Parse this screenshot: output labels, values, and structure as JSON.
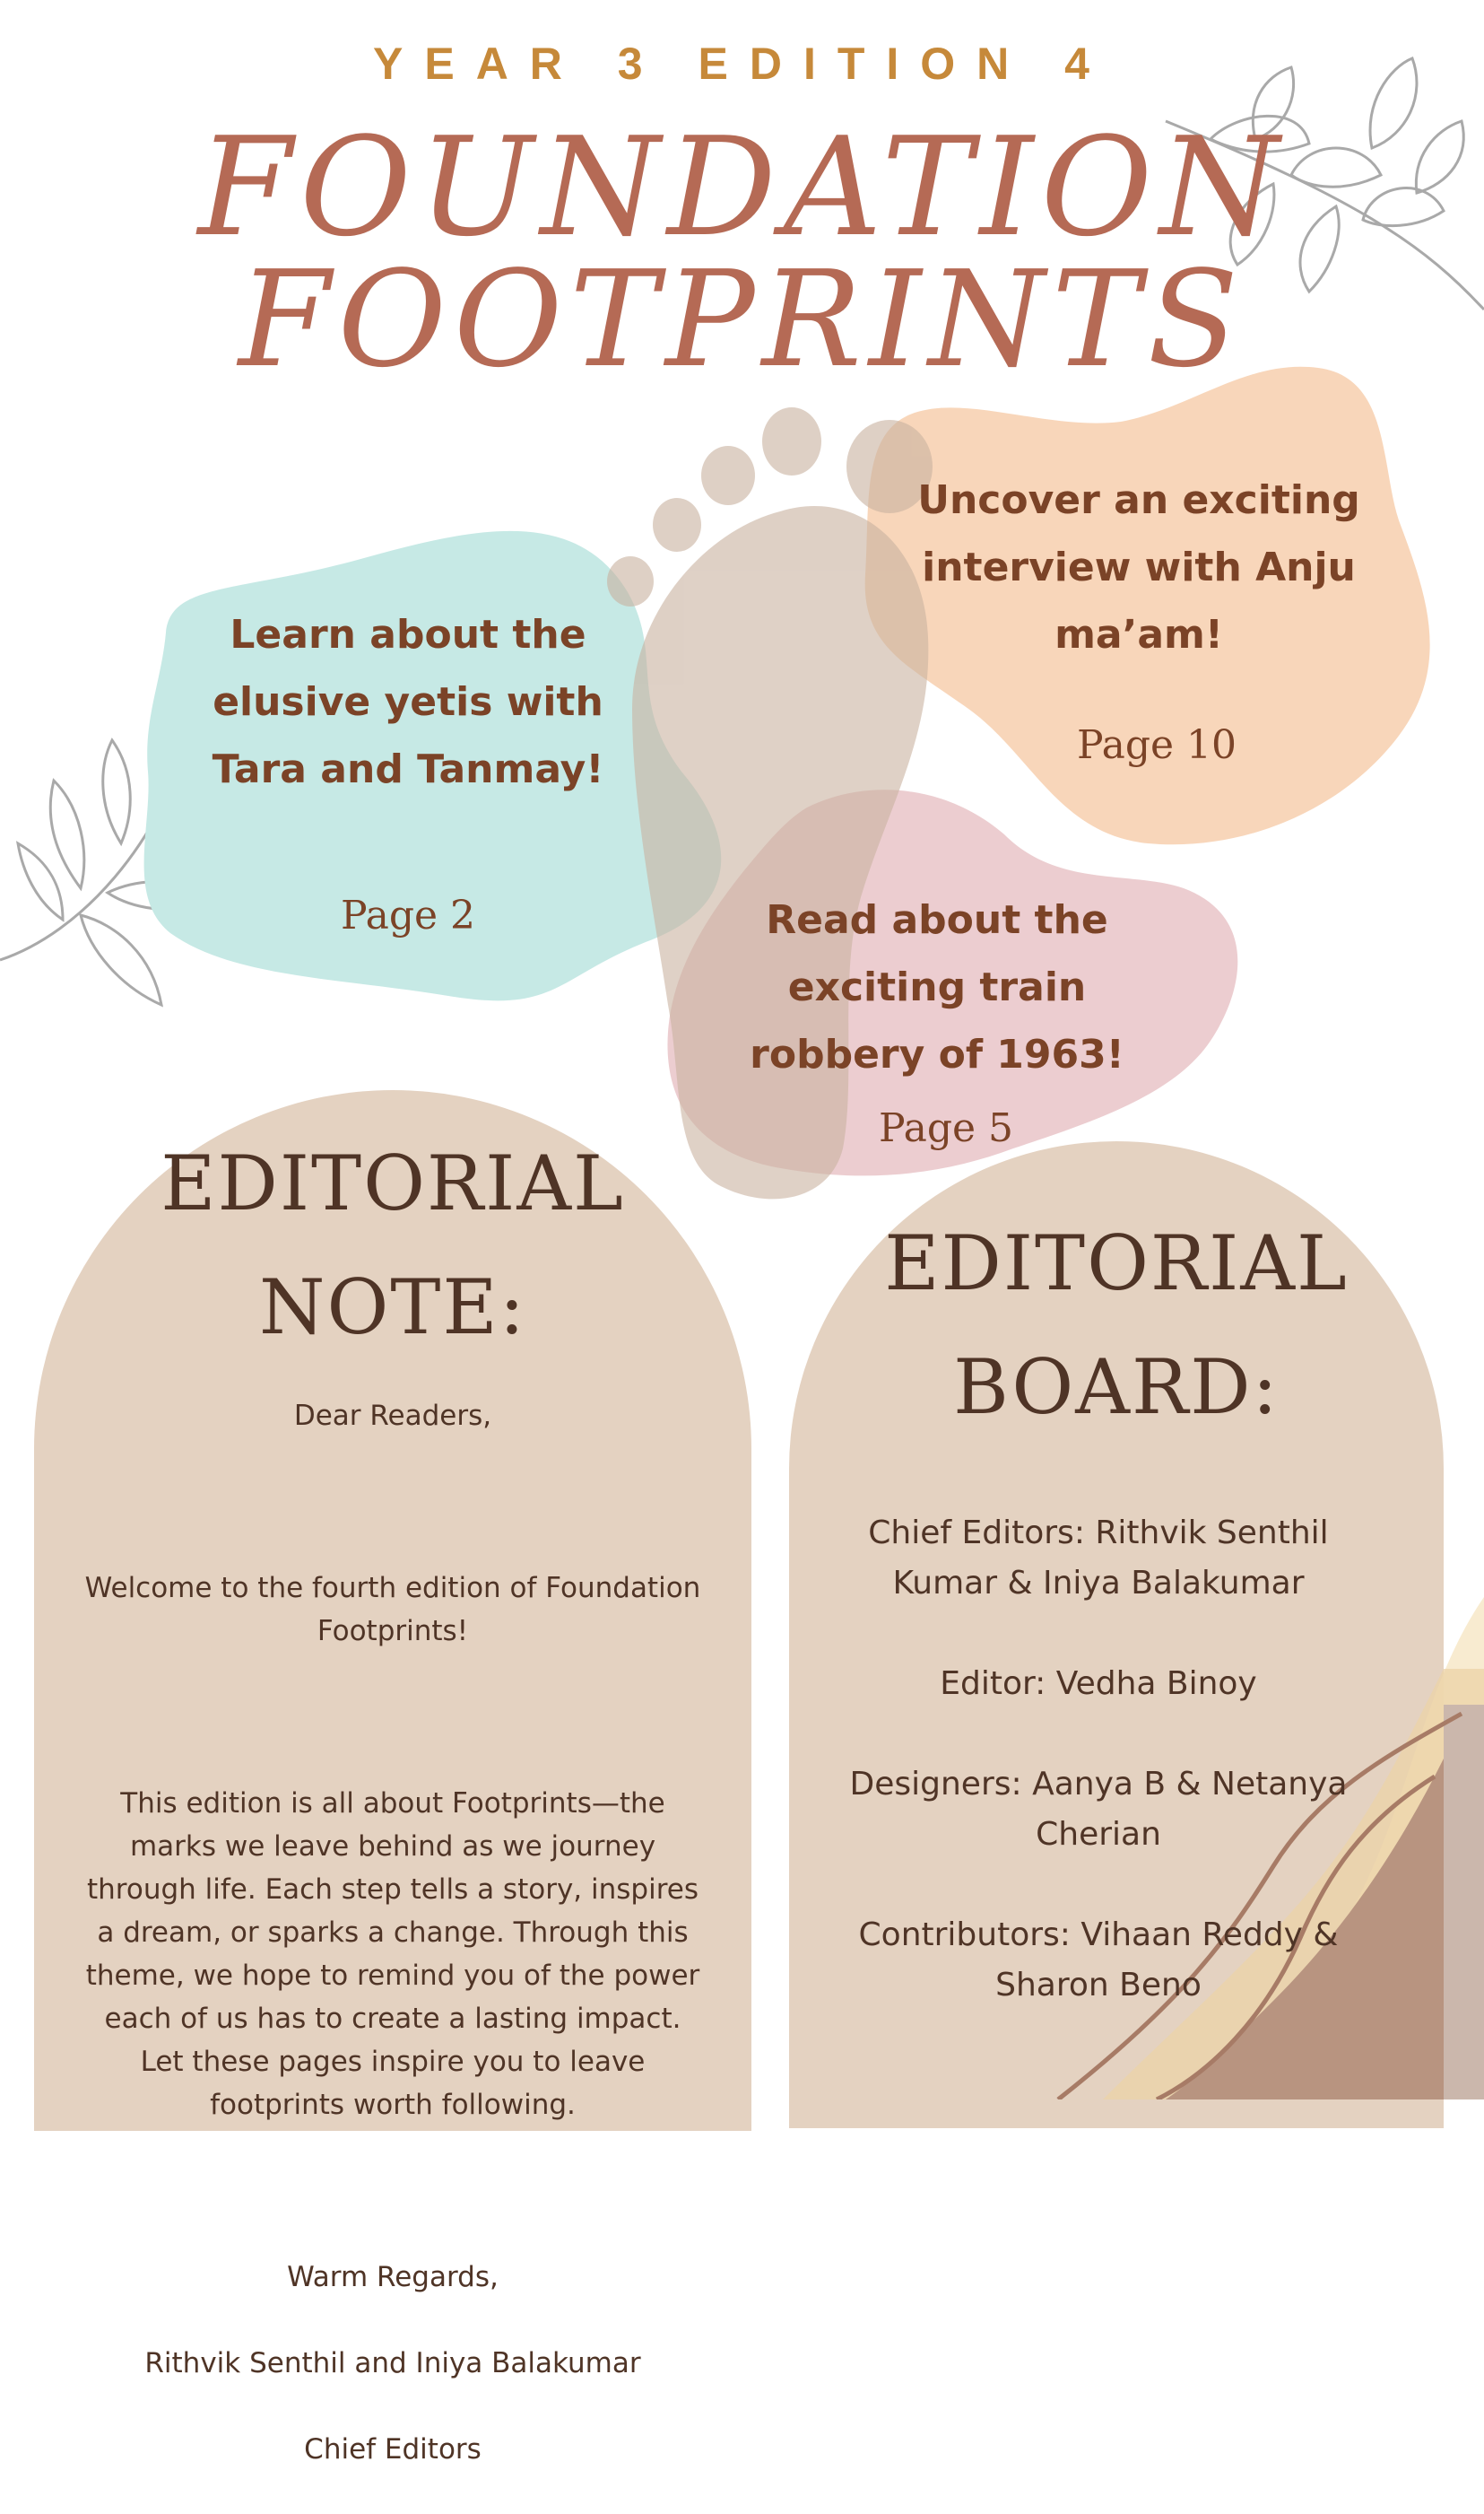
{
  "header": {
    "kicker": "YEAR 3 EDITION 4",
    "title_line1": "FOUNDATION",
    "title_line2": "FOOTPRINTS"
  },
  "features": [
    {
      "text": "Learn about the elusive yetis with Tara and Tanmay!",
      "page": "Page  2"
    },
    {
      "text": "Uncover an exciting interview with Anju ma’am!",
      "page": "Page  10"
    },
    {
      "text": "Read about the exciting train robbery of 1963!",
      "page": "Page  5"
    }
  ],
  "editorial_note": {
    "heading_line1": "EDITORIAL",
    "heading_line2": "NOTE:",
    "greeting": "Dear Readers,",
    "para1": "Welcome to the fourth edition of Foundation Footprints!",
    "para2": "This edition is all about Footprints—the marks we leave behind as we journey through life. Each step tells a story, inspires a dream, or sparks a change. Through this theme, we hope to remind you of the power each of us has to create a lasting impact. Let these pages inspire you to leave footprints worth following.",
    "sign1": "Warm Regards,",
    "sign2": "Rithvik Senthil and Iniya Balakumar",
    "sign3": "Chief Editors"
  },
  "editorial_board": {
    "heading_line1": "EDITORIAL",
    "heading_line2": "BOARD:",
    "items": [
      "Chief Editors: Rithvik Senthil Kumar & Iniya Balakumar",
      "Editor:  Vedha Binoy",
      "Designers: Aanya B & Netanya Cherian",
      "Contributors: Vihaan Reddy & Sharon Beno"
    ]
  },
  "colors": {
    "kicker": "#c6893a",
    "title": "#b56a55",
    "blob_teal": "#c6e9e5",
    "blob_peach": "#f8d4b6",
    "blob_pink": "#ebcacd",
    "foot": "#c9b2a0",
    "arch": "#e4d2c1",
    "text_dark": "#4f3426",
    "text_brown": "#7b4327"
  },
  "icons": [
    "leaf-branch-icon",
    "footprint-icon"
  ]
}
